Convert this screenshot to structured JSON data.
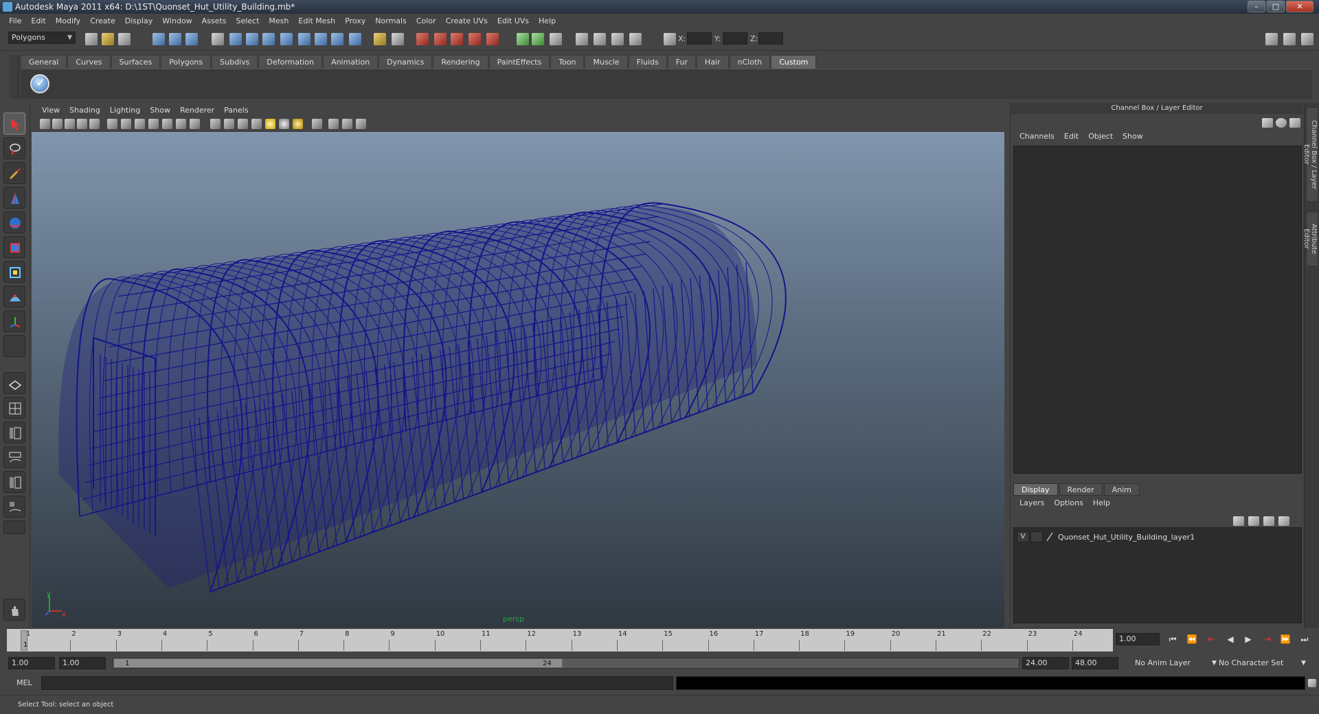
{
  "window": {
    "title": "Autodesk Maya 2011 x64: D:\\1ST\\Quonset_Hut_Utility_Building.mb*",
    "minimize": "–",
    "maximize": "□",
    "close": "✕"
  },
  "menubar": [
    "File",
    "Edit",
    "Modify",
    "Create",
    "Display",
    "Window",
    "Assets",
    "Select",
    "Mesh",
    "Edit Mesh",
    "Proxy",
    "Normals",
    "Color",
    "Create UVs",
    "Edit UVs",
    "Help"
  ],
  "statusline": {
    "mode": "Polygons",
    "x_label": "X:",
    "y_label": "Y:",
    "z_label": "Z:"
  },
  "shelf": {
    "tabs": [
      "General",
      "Curves",
      "Surfaces",
      "Polygons",
      "Subdivs",
      "Deformation",
      "Animation",
      "Dynamics",
      "Rendering",
      "PaintEffects",
      "Toon",
      "Muscle",
      "Fluids",
      "Fur",
      "Hair",
      "nCloth",
      "Custom"
    ],
    "active_tab": "Custom"
  },
  "viewport": {
    "menu": [
      "View",
      "Shading",
      "Lighting",
      "Show",
      "Renderer",
      "Panels"
    ],
    "camera": "persp",
    "axis_x": "x",
    "axis_y": "y",
    "model_color": "#14148a"
  },
  "channel_box": {
    "title": "Channel Box / Layer Editor",
    "menu": [
      "Channels",
      "Edit",
      "Object",
      "Show"
    ]
  },
  "layer_editor": {
    "tabs": [
      "Display",
      "Render",
      "Anim"
    ],
    "active_tab": "Display",
    "menu": [
      "Layers",
      "Options",
      "Help"
    ],
    "layers": [
      {
        "visible": "V",
        "name": "Quonset_Hut_Utility_Building_layer1"
      }
    ]
  },
  "side_tabs": [
    "Channel Box / Layer Editor",
    "Attribute Editor"
  ],
  "time_slider": {
    "ticks": [
      "1",
      "2",
      "3",
      "4",
      "5",
      "6",
      "7",
      "8",
      "9",
      "10",
      "11",
      "12",
      "13",
      "14",
      "15",
      "16",
      "17",
      "18",
      "19",
      "20",
      "21",
      "22",
      "23",
      "24"
    ],
    "current_frame_label": "1",
    "current_time": "1.00"
  },
  "range_slider": {
    "start_time": "1.00",
    "playback_start": "1.00",
    "range_start_label": "1",
    "range_end_label": "24",
    "playback_end": "24.00",
    "end_time": "48.00",
    "anim_layer": "No Anim Layer",
    "character_set": "No Character Set"
  },
  "command_line": {
    "label": "MEL"
  },
  "help_line": {
    "text": "Select Tool: select an object"
  }
}
